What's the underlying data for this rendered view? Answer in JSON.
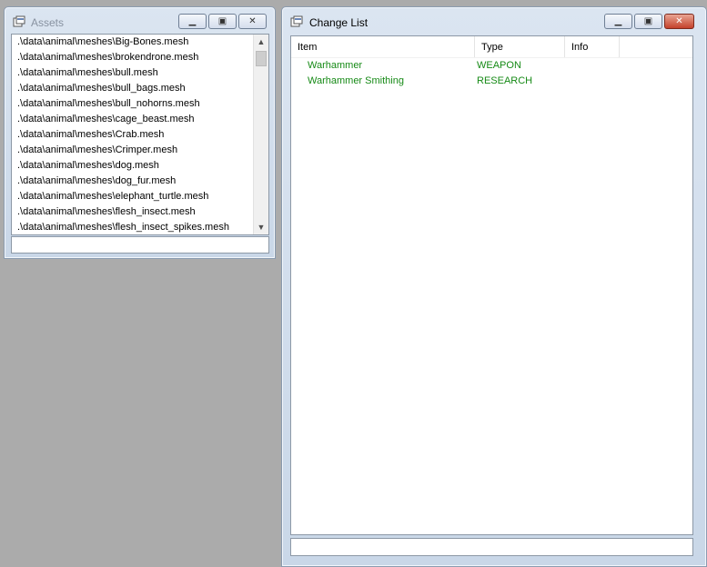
{
  "assets_window": {
    "title": "Assets",
    "items": [
      ".\\data\\animal\\meshes\\Big-Bones.mesh",
      ".\\data\\animal\\meshes\\brokendrone.mesh",
      ".\\data\\animal\\meshes\\bull.mesh",
      ".\\data\\animal\\meshes\\bull_bags.mesh",
      ".\\data\\animal\\meshes\\bull_nohorns.mesh",
      ".\\data\\animal\\meshes\\cage_beast.mesh",
      ".\\data\\animal\\meshes\\Crab.mesh",
      ".\\data\\animal\\meshes\\Crimper.mesh",
      ".\\data\\animal\\meshes\\dog.mesh",
      ".\\data\\animal\\meshes\\dog_fur.mesh",
      ".\\data\\animal\\meshes\\elephant_turtle.mesh",
      ".\\data\\animal\\meshes\\flesh_insect.mesh",
      ".\\data\\animal\\meshes\\flesh_insect_spikes.mesh"
    ],
    "input_value": ""
  },
  "change_list_window": {
    "title": "Change List",
    "columns": [
      "Item",
      "Type",
      "Info"
    ],
    "rows": [
      {
        "item": "Warhammer",
        "type": "WEAPON",
        "info": ""
      },
      {
        "item": "Warhammer Smithing",
        "type": "RESEARCH",
        "info": ""
      }
    ],
    "input_value": ""
  },
  "icons": {
    "minimize": "minimize-icon",
    "restore": "restore-icon",
    "close": "close-icon",
    "window": "window-icon",
    "scroll_up": "chevron-up-icon",
    "scroll_down": "chevron-down-icon"
  },
  "colors": {
    "desktop": "#ababab",
    "row_text": "#168a16",
    "close_button": "#c4412b"
  }
}
